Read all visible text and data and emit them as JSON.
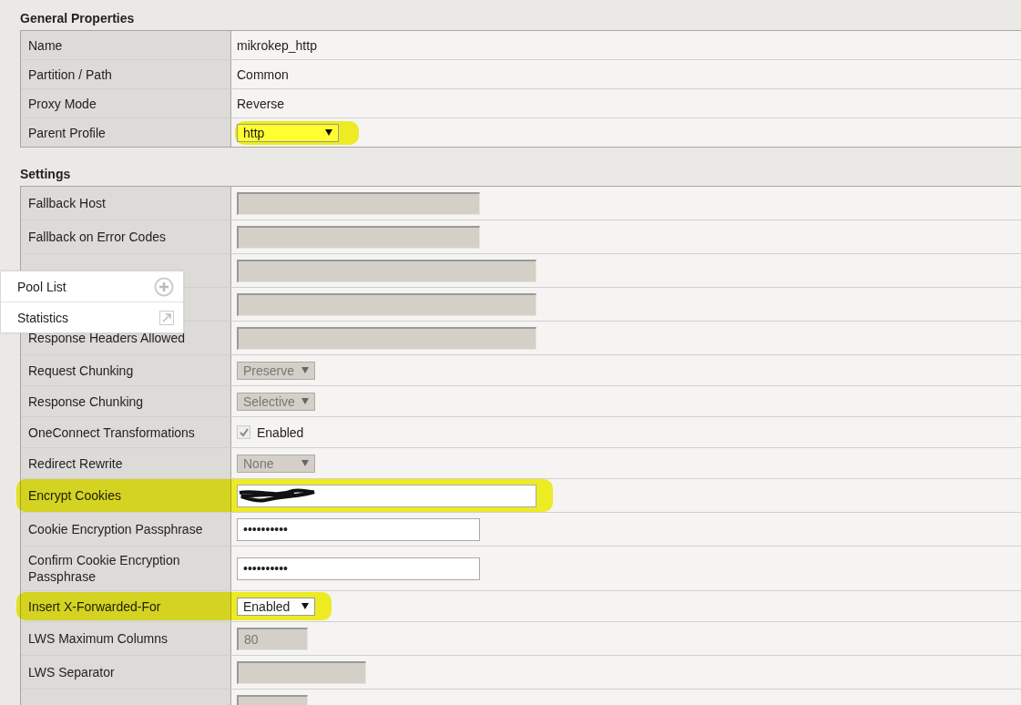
{
  "sections": [
    {
      "title": "General Properties",
      "rows": [
        {
          "label": "Name",
          "value": {
            "kind": "text",
            "text": "mikrokep_http"
          },
          "highlighted": false
        },
        {
          "label": "Partition / Path",
          "value": {
            "kind": "text",
            "text": "Common"
          },
          "highlighted": false
        },
        {
          "label": "Proxy Mode",
          "value": {
            "kind": "text",
            "text": "Reverse"
          },
          "highlighted": false
        },
        {
          "label": "Parent Profile",
          "value": {
            "kind": "select",
            "text": "http",
            "disabled": false
          },
          "highlighted": true
        }
      ]
    },
    {
      "title": "Settings",
      "rows": [
        {
          "label": "Fallback Host",
          "value": {
            "kind": "input",
            "disabled": true
          },
          "highlighted": false
        },
        {
          "label": "Fallback on Error Codes",
          "value": {
            "kind": "input",
            "disabled": true
          },
          "highlighted": false
        },
        {
          "value": {
            "kind": "input",
            "disabled": true
          },
          "highlighted": false
        },
        {
          "value": {
            "kind": "input",
            "disabled": true
          },
          "highlighted": false
        },
        {
          "label": "Response Headers Allowed",
          "value": {
            "kind": "input",
            "disabled": true
          },
          "highlighted": false
        },
        {
          "label": "Request Chunking",
          "value": {
            "kind": "select",
            "text": "Preserve",
            "disabled": true
          },
          "highlighted": false
        },
        {
          "label": "Response Chunking",
          "value": {
            "kind": "select",
            "text": "Selective",
            "disabled": true
          },
          "highlighted": false
        },
        {
          "label": "OneConnect Transformations",
          "value": {
            "kind": "checkbox",
            "text": "Enabled",
            "checked": true,
            "disabled": true
          },
          "highlighted": false
        },
        {
          "label": "Redirect Rewrite",
          "value": {
            "kind": "select",
            "text": "None",
            "disabled": true
          },
          "highlighted": false
        },
        {
          "label": "Encrypt Cookies",
          "value": {
            "kind": "input",
            "disabled": false,
            "redacted": true
          },
          "highlighted": true
        },
        {
          "label": "Cookie Encryption Passphrase",
          "value": {
            "kind": "input",
            "text": "••••••••••",
            "disabled": false
          },
          "highlighted": false
        },
        {
          "label": "Confirm Cookie Encryption Passphrase",
          "value": {
            "kind": "input",
            "text": "••••••••••",
            "disabled": false
          },
          "highlighted": false
        },
        {
          "label": "Insert X-Forwarded-For",
          "value": {
            "kind": "select",
            "text": "Enabled",
            "disabled": false
          },
          "highlighted": true
        },
        {
          "label": "LWS Maximum Columns",
          "value": {
            "kind": "input",
            "text": "80",
            "disabled": true
          },
          "highlighted": false
        },
        {
          "label": "LWS Separator",
          "value": {
            "kind": "input",
            "disabled": true
          },
          "highlighted": false
        },
        {
          "value": {
            "kind": "input",
            "disabled": true
          },
          "highlighted": false
        }
      ]
    }
  ],
  "popup_menu": {
    "items": [
      {
        "label": "Pool List"
      },
      {
        "label": "Statistics"
      }
    ]
  }
}
